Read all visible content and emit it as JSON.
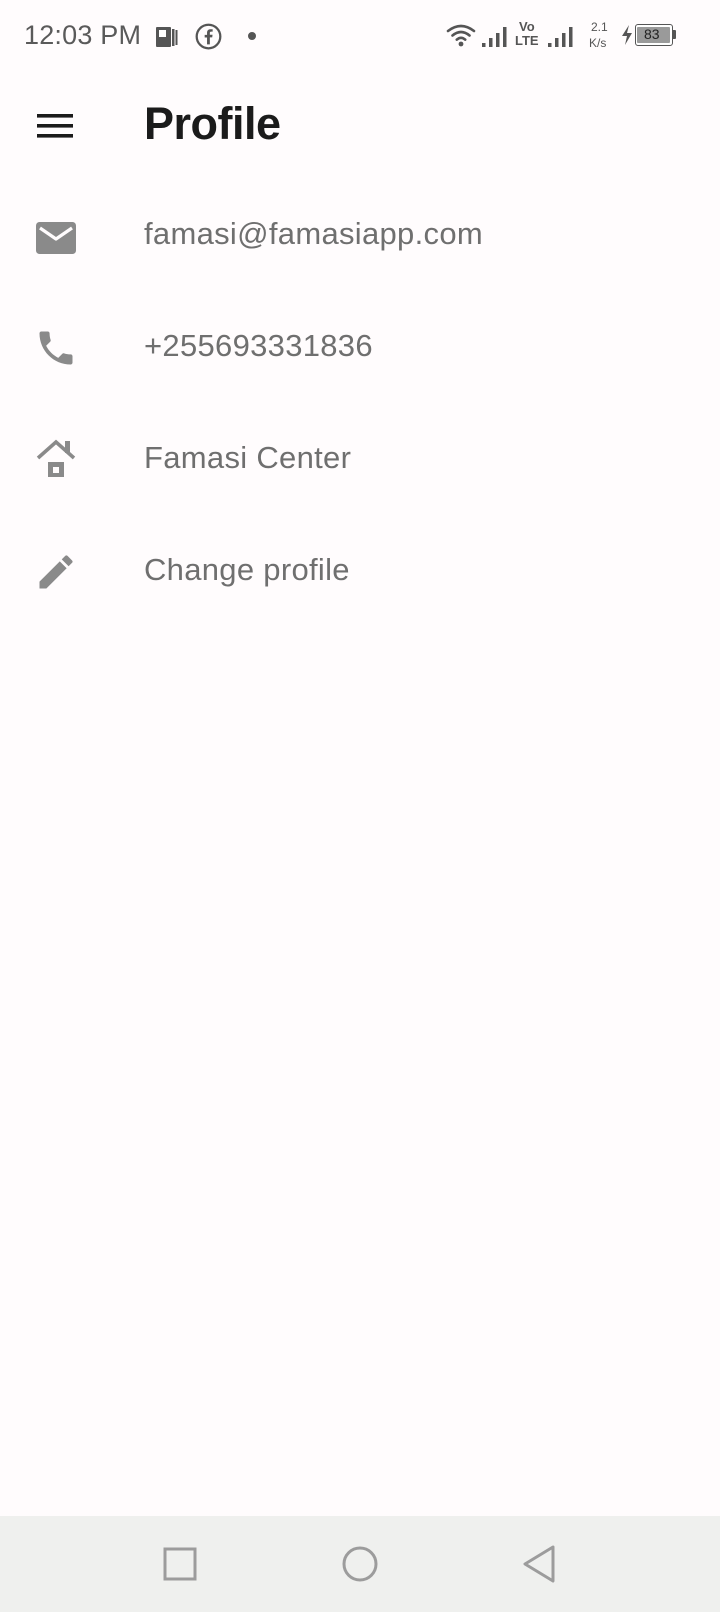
{
  "status_bar": {
    "time": "12:03 PM",
    "net_speed_value": "2.1",
    "net_speed_unit": "K/s",
    "battery": "83",
    "volte_top": "Vo",
    "volte_bottom": "LTE",
    "icons": [
      "news-app-icon",
      "facebook-icon",
      "notification-dot-icon",
      "wifi-icon",
      "signal-icon",
      "volte-icon",
      "signal-icon",
      "charging-icon",
      "battery-icon"
    ]
  },
  "app_bar": {
    "title": "Profile",
    "menu_icon": "hamburger-menu-icon"
  },
  "profile": {
    "items": [
      {
        "icon": "email-icon",
        "text": "famasi@famasiapp.com"
      },
      {
        "icon": "phone-icon",
        "text": "+255693331836"
      },
      {
        "icon": "home-icon",
        "text": "Famasi Center"
      },
      {
        "icon": "edit-pencil-icon",
        "text": "Change profile"
      }
    ]
  },
  "nav_bar": {
    "buttons": [
      "recents-square-icon",
      "home-circle-icon",
      "back-triangle-icon"
    ]
  },
  "colors": {
    "background": "#fffcfd",
    "title": "#1b1b1b",
    "item_text": "#6f6f6f",
    "icon": "#8a8a8a",
    "nav_bar": "#eff0ee"
  }
}
